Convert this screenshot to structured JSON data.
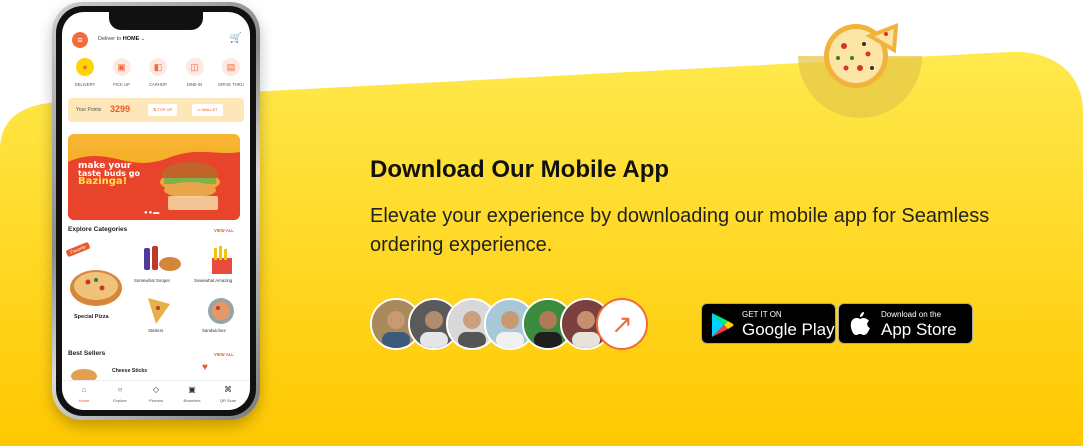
{
  "colors": {
    "accent": "#f36b3b",
    "banner_yellow": "#ffd21a",
    "text_dark": "#111111"
  },
  "phone": {
    "topbar": {
      "menu_icon": "menu-icon",
      "deliver_prefix": "Deliver to",
      "deliver_place": "HOME",
      "cart_icon": "cart-icon"
    },
    "services": [
      {
        "label": "DELIVERY",
        "icon": "location-pin-icon"
      },
      {
        "label": "PICK UP",
        "icon": "store-icon"
      },
      {
        "label": "CARHOP",
        "icon": "car-icon"
      },
      {
        "label": "DINE IN",
        "icon": "dine-icon"
      },
      {
        "label": "DRIVE THRU",
        "icon": "drive-thru-icon"
      }
    ],
    "points": {
      "label": "Your Points",
      "value": "3299",
      "topup": "TOP UP",
      "wallet": "WALLET"
    },
    "promo": {
      "line1": "make your",
      "line2": "taste buds go",
      "line3": "Bazinga!"
    },
    "explore": {
      "title": "Explore Categories",
      "view_all": "VIEW ALL"
    },
    "categories": {
      "favorite_badge": "Favorite",
      "special": "Special Pizza",
      "c1": "Somewhat Sooper",
      "c2": "Sowewhat Amazing",
      "c3": "Starters",
      "c4": "Sandwiches"
    },
    "best_sellers": {
      "title": "Best Sellers",
      "view_all": "VIEW ALL",
      "item": "Cheese Sticks"
    },
    "nav": [
      {
        "label": "Home",
        "icon": "home-icon"
      },
      {
        "label": "Explore",
        "icon": "search-icon"
      },
      {
        "label": "Promos",
        "icon": "tag-icon"
      },
      {
        "label": "Branches",
        "icon": "branch-icon"
      },
      {
        "label": "QR Scan",
        "icon": "qr-icon"
      }
    ]
  },
  "content": {
    "headline": "Download Our Mobile App",
    "subtext": "Elevate your experience by downloading our mobile app for Seamless ordering experience."
  },
  "stores": {
    "google": {
      "small": "GET IT ON",
      "big": "Google Play"
    },
    "apple": {
      "small": "Download on the",
      "big": "App Store"
    }
  }
}
